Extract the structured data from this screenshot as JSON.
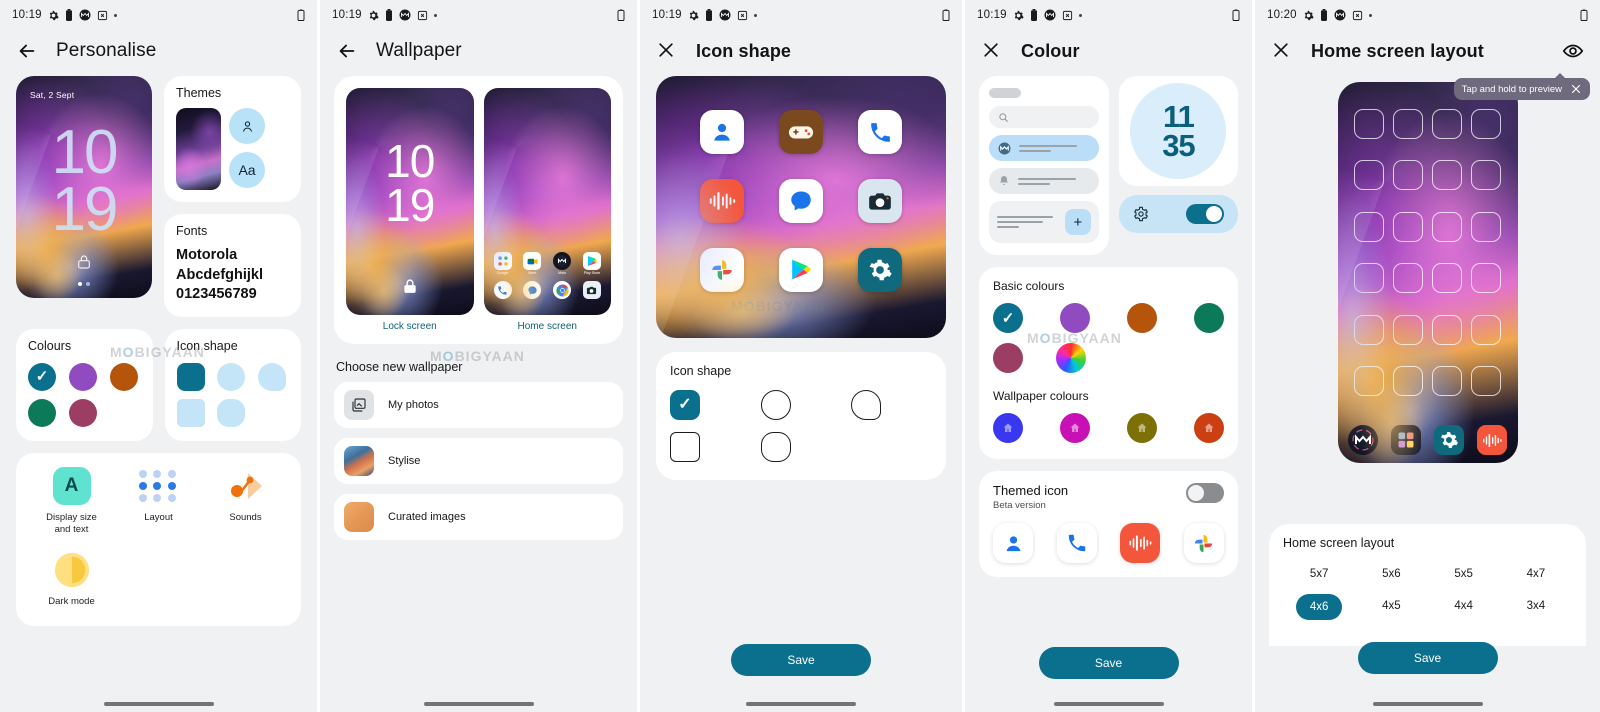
{
  "panels": [
    {
      "id": "personalise",
      "statusbar": {
        "clock": "10:19",
        "icons": [
          "gear-icon",
          "battery-icon",
          "motorola-icon",
          "screenshot-icon",
          "dot-icon"
        ],
        "right_icon": "battery-icon"
      },
      "appbar": {
        "nav_icon": "back-arrow-icon",
        "title": "Personalise"
      },
      "lock_preview": {
        "date": "Sat, 2 Sept",
        "time_hour": "10",
        "time_minute": "19",
        "lock_icon": "lock-icon"
      },
      "themes": {
        "title": "Themes",
        "chip_person": "person-icon",
        "chip_font": "Aa"
      },
      "fonts": {
        "title": "Fonts",
        "line1": "Motorola",
        "line2": "Abcdefghijkl",
        "line3": "0123456789"
      },
      "colours": {
        "title": "Colours",
        "swatches": [
          "#0b6f8e",
          "#8f4bbf",
          "#b4550b",
          "#0c7a58",
          "#9c3d63"
        ],
        "selected_index": 0
      },
      "icon_shape": {
        "title": "Icon shape",
        "shapes": [
          "squircle",
          "circle",
          "teardrop",
          "rounded-square",
          "squircle-soft"
        ],
        "selected_index": 0,
        "selected_color": "#0b6f8e",
        "unselected_color": "#c4e4f8"
      },
      "tiles": [
        {
          "label": "Display size\nand text",
          "icon": "display-size-icon"
        },
        {
          "label": "Layout",
          "icon": "layout-grid-icon"
        },
        {
          "label": "Sounds",
          "icon": "sounds-icon"
        },
        {
          "label": "Dark mode",
          "icon": "dark-mode-icon"
        }
      ],
      "watermark": "MOBIGYAAN"
    },
    {
      "id": "wallpaper",
      "statusbar": {
        "clock": "10:19"
      },
      "appbar": {
        "nav_icon": "back-arrow-icon",
        "title": "Wallpaper"
      },
      "previews": {
        "lock": {
          "label": "Lock screen",
          "time_hour": "10",
          "time_minute": "19",
          "lock_icon": "lock-icon"
        },
        "home": {
          "label": "Home screen",
          "row1": [
            {
              "name": "Google",
              "icon": "google-folder-icon"
            },
            {
              "name": "Meet",
              "icon": "meet-icon"
            },
            {
              "name": "Moto",
              "icon": "moto-icon"
            },
            {
              "name": "Play Store",
              "icon": "play-store-icon"
            }
          ],
          "row2": [
            {
              "name": "Phone",
              "icon": "phone-icon"
            },
            {
              "name": "Messages",
              "icon": "messages-icon"
            },
            {
              "name": "Chrome",
              "icon": "chrome-icon"
            },
            {
              "name": "Camera",
              "icon": "camera-icon"
            }
          ]
        }
      },
      "section_title": "Choose new wallpaper",
      "items": [
        {
          "label": "My photos",
          "icon": "photo-library-icon"
        },
        {
          "label": "Stylise",
          "icon": "stylise-thumb"
        },
        {
          "label": "Curated images",
          "icon": "curated-thumb"
        }
      ],
      "watermark": "MOBIGYAAN"
    },
    {
      "id": "icon-shape",
      "statusbar": {
        "clock": "10:19"
      },
      "appbar": {
        "nav_icon": "close-icon",
        "title": "Icon shape"
      },
      "preview_icons": [
        {
          "name": "contacts-icon",
          "bg": "#ffffff"
        },
        {
          "name": "games-icon",
          "bg": "#7a4a1e"
        },
        {
          "name": "phone-icon",
          "bg": "#ffffff"
        },
        {
          "name": "recorder-icon",
          "bg": "#f4563c"
        },
        {
          "name": "messages-icon",
          "bg": "#ffffff"
        },
        {
          "name": "camera-icon",
          "bg": "#d9e6ef"
        },
        {
          "name": "photos-icon",
          "bg": "#ffffff"
        },
        {
          "name": "play-store-icon",
          "bg": "#ffffff"
        },
        {
          "name": "settings-icon",
          "bg": "#0f6a7d"
        }
      ],
      "card": {
        "title": "Icon shape",
        "shapes": [
          "squircle",
          "circle",
          "teardrop",
          "rounded-square",
          "squircle-soft"
        ],
        "selected_index": 0,
        "selected_color": "#0b6f8e"
      },
      "save_label": "Save",
      "watermark": "MOBIGYAAN"
    },
    {
      "id": "colour",
      "statusbar": {
        "clock": "10:19"
      },
      "appbar": {
        "nav_icon": "close-icon",
        "title": "Colour"
      },
      "mock": {
        "search_icon": "search-icon",
        "row_icon_1": "motorola-icon",
        "row_icon_2": "bell-icon",
        "plus_icon": "plus-icon",
        "clock_hour": "11",
        "clock_minute": "35",
        "gear_icon": "gear-icon",
        "toggle_on": true
      },
      "basic_colours": {
        "title": "Basic colours",
        "swatches": [
          "#0b6f8e",
          "#8f4bbf",
          "#b4550b",
          "#0c7a58",
          "#9c3d63",
          "colour-wheel"
        ],
        "selected_index": 0
      },
      "wallpaper_colours": {
        "title": "Wallpaper colours",
        "swatches": [
          "#3a37f0",
          "#c711b4",
          "#7d7007",
          "#cc3f12"
        ]
      },
      "themed_icon": {
        "title": "Themed icon",
        "subtitle": "Beta version",
        "toggle_on": false,
        "icons": [
          {
            "name": "contacts-icon",
            "bg": "#ffffff"
          },
          {
            "name": "phone-icon",
            "bg": "#ffffff"
          },
          {
            "name": "recorder-icon",
            "bg": "#f4563c"
          },
          {
            "name": "photos-icon",
            "bg": "#ffffff"
          }
        ]
      },
      "save_label": "Save",
      "watermark": "MOBIGYAAN"
    },
    {
      "id": "home-screen-layout",
      "statusbar": {
        "clock": "10:20"
      },
      "appbar": {
        "nav_icon": "close-icon",
        "title": "Home screen layout",
        "action_icon": "eye-preview-icon"
      },
      "tooltip": {
        "text": "Tap and hold to preview",
        "close_icon": "close-icon"
      },
      "preview": {
        "rows": 6,
        "cols": 4,
        "dock": [
          {
            "name": "moto-icon"
          },
          {
            "name": "app-drawer-icon"
          },
          {
            "name": "settings-icon"
          },
          {
            "name": "recorder-icon"
          }
        ]
      },
      "card": {
        "title": "Home screen layout",
        "options": [
          "5x7",
          "5x6",
          "5x5",
          "4x7",
          "4x6",
          "4x5",
          "4x4",
          "3x4"
        ],
        "selected": "4x6"
      },
      "save_label": "Save"
    }
  ]
}
